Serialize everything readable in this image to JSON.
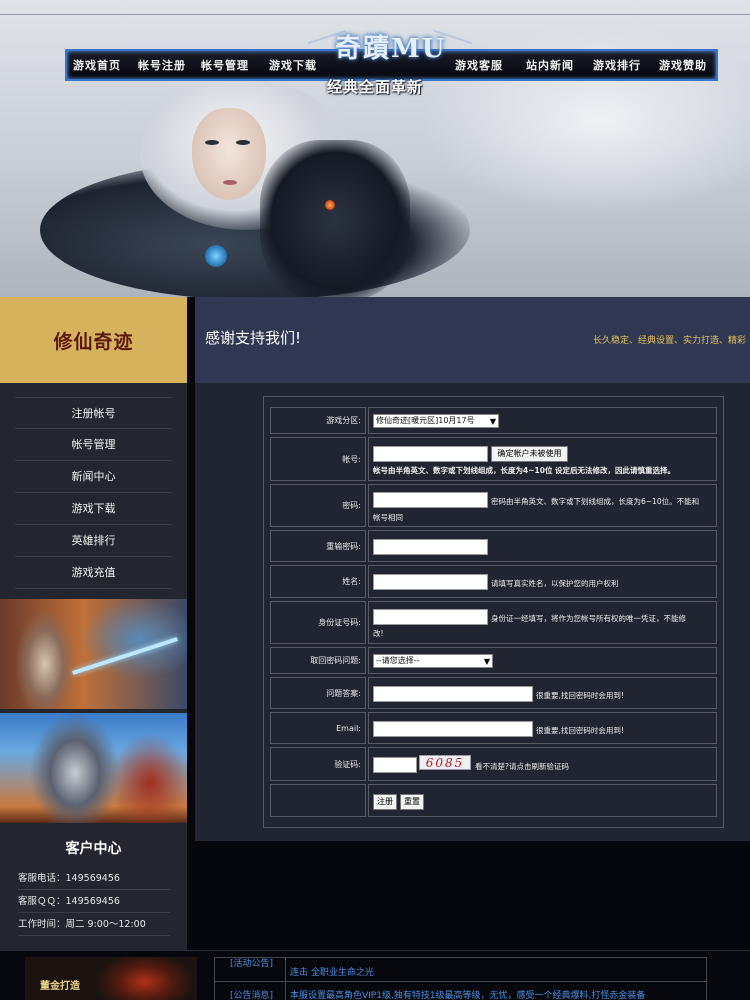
{
  "nav": {
    "items": [
      "游戏首页",
      "帐号注册",
      "帐号管理",
      "游戏下载",
      "游戏客服",
      "站内新闻",
      "游戏排行",
      "游戏赞助"
    ]
  },
  "logo": {
    "main": "奇蹟MU",
    "sub": "经典全面革新"
  },
  "sidebar": {
    "site_title": "修仙奇迹",
    "menu": [
      "注册帐号",
      "帐号管理",
      "新闻中心",
      "游戏下载",
      "英雄排行",
      "游戏充值"
    ],
    "customer_center": {
      "title": "客户中心",
      "rows": [
        {
          "label": "客服电话：",
          "value": "149569456"
        },
        {
          "label": "客服ＱＱ：",
          "value": "149569456"
        },
        {
          "label": "工作时间：",
          "value": "周二 9:00～12:00"
        }
      ]
    }
  },
  "main": {
    "title": "感谢支持我们!",
    "marquee": "长久稳定、经典设置、实力打造、精彩"
  },
  "form": {
    "server": {
      "label": "游戏分区:",
      "selected": "修仙奇迹[暖元区]10月17号"
    },
    "account": {
      "label": "帐号:",
      "check_button": "确定帐户未被使用",
      "hint": "帐号由半角英文、数字或下划线组成，长度为4~10位 设定后无法修改，因此请慎重选择。"
    },
    "password": {
      "label": "密码:",
      "hint_line1": "密码由半角英文、数字或下划线组成，长度为6~10位。不能和",
      "hint_line2": "帐号相同"
    },
    "confirm_password": {
      "label": "重输密码:"
    },
    "name": {
      "label": "姓名:",
      "hint": "请填写真实姓名，以保护您的用户权利"
    },
    "id_number": {
      "label": "身份证号码:",
      "hint_line1": "身份证一经填写，将作为您帐号所有权的唯一凭证，不能修",
      "hint_line2": "改!"
    },
    "question": {
      "label": "取回密码问题:",
      "selected": "--请您选择--"
    },
    "answer": {
      "label": "问题答案:",
      "hint": "很重要,找回密码时会用到!"
    },
    "email": {
      "label": "Email:",
      "hint": "很重要,找回密码时会用到!"
    },
    "captcha": {
      "label": "验证码:",
      "code": "6085",
      "hint": "看不清楚?请点击刷新验证码"
    },
    "buttons": {
      "submit": "注册",
      "reset": "重置"
    }
  },
  "bottom": {
    "left_label": "董金打造",
    "rows": [
      {
        "tag": "[活动公告]",
        "text": "连击 全职业生命之光"
      },
      {
        "tag": "[公告消息]",
        "text": "本服设置最高角色VIP1级,独有特技1级最高等级，无忧，感受一个经典爆料,打怪赤金装备"
      }
    ]
  }
}
